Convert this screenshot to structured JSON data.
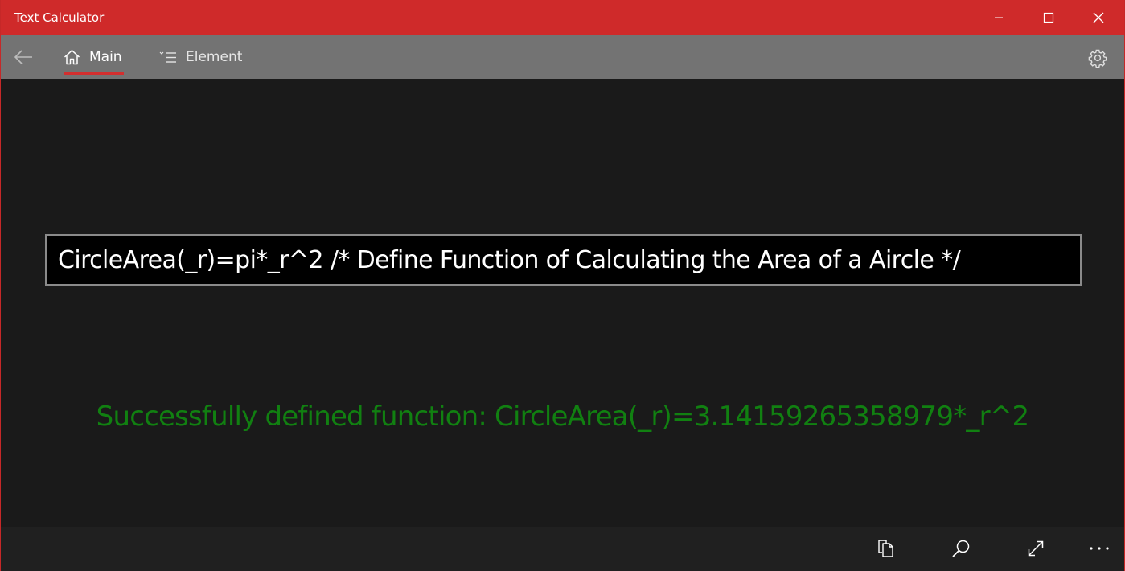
{
  "window": {
    "title": "Text Calculator",
    "accent_color": "#cf2a2a"
  },
  "titlebar_buttons": {
    "minimize_icon": "minimize-icon",
    "maximize_icon": "maximize-icon",
    "close_icon": "close-icon"
  },
  "nav": {
    "back_icon": "back-arrow-icon",
    "tabs": [
      {
        "label": "Main",
        "icon": "home-icon",
        "selected": true
      },
      {
        "label": "Element",
        "icon": "list-icon",
        "selected": false
      }
    ],
    "settings_icon": "gear-icon"
  },
  "main": {
    "expression_value": "CircleArea(_r)=pi*_r^2 /* Define Function of Calculating the Area of a Aircle */",
    "result_text": "Successfully defined function: CircleArea(_r)=3.14159265358979*_r^2",
    "result_color": "#118011"
  },
  "command_bar": {
    "buttons": [
      {
        "icon": "copy-icon"
      },
      {
        "icon": "search-icon"
      },
      {
        "icon": "expand-icon"
      },
      {
        "icon": "more-icon"
      }
    ]
  }
}
